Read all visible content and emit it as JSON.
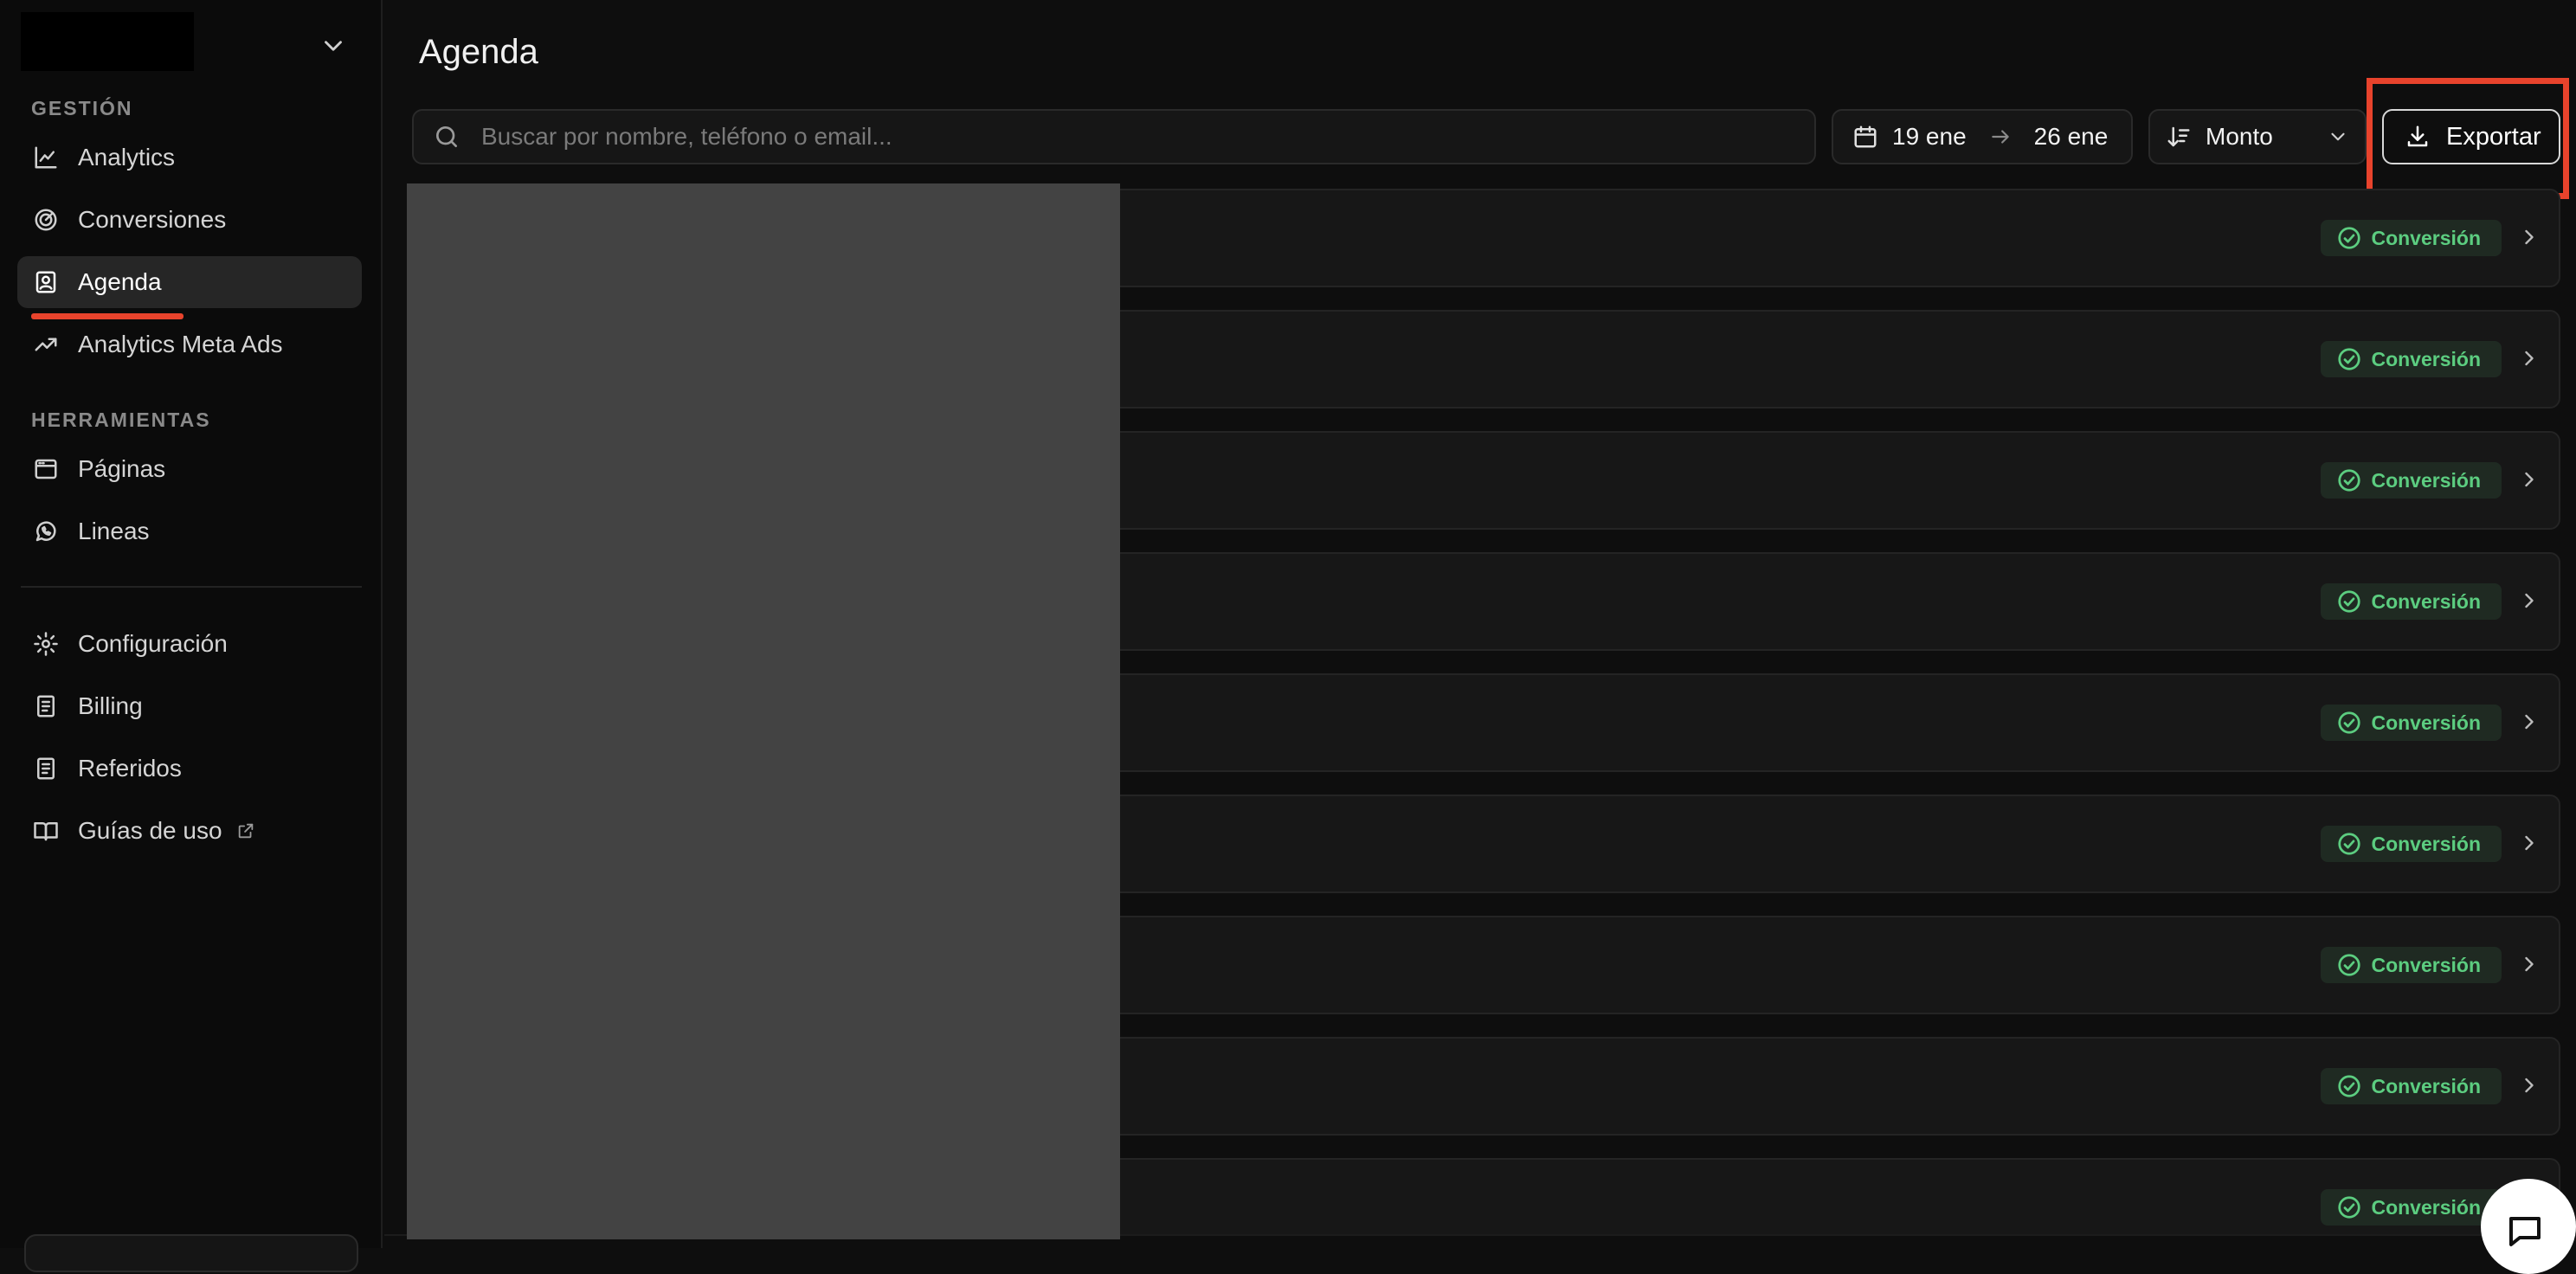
{
  "sidebar": {
    "sections": {
      "gestion": "GESTIÓN",
      "herramientas": "HERRAMIENTAS"
    },
    "items": [
      {
        "label": "Analytics",
        "icon": "line-chart-icon"
      },
      {
        "label": "Conversiones",
        "icon": "target-icon"
      },
      {
        "label": "Agenda",
        "icon": "contact-book-icon",
        "active": true
      },
      {
        "label": "Analytics Meta Ads",
        "icon": "trending-up-icon"
      },
      {
        "label": "Páginas",
        "icon": "browser-window-icon"
      },
      {
        "label": "Lineas",
        "icon": "whatsapp-icon"
      },
      {
        "label": "Configuración",
        "icon": "gear-icon"
      },
      {
        "label": "Billing",
        "icon": "receipt-icon"
      },
      {
        "label": "Referidos",
        "icon": "receipt-icon"
      },
      {
        "label": "Guías de uso",
        "icon": "book-icon",
        "external": true
      }
    ]
  },
  "page": {
    "title": "Agenda"
  },
  "toolbar": {
    "search_placeholder": "Buscar por nombre, teléfono o email...",
    "date_from": "19 ene",
    "date_to": "26 ene",
    "sort_label": "Monto",
    "export_label": "Exportar"
  },
  "rows": [
    {
      "badge": "Conversión"
    },
    {
      "badge": "Conversión"
    },
    {
      "badge": "Conversión"
    },
    {
      "badge": "Conversión"
    },
    {
      "badge": "Conversión"
    },
    {
      "badge": "Conversión"
    },
    {
      "badge": "Conversión"
    },
    {
      "badge": "Conversión"
    },
    {
      "badge": "Conversión"
    }
  ],
  "colors": {
    "accent_annotation": "#e8432c",
    "badge_text": "#5ccd80",
    "badge_bg": "#1f2a22"
  }
}
